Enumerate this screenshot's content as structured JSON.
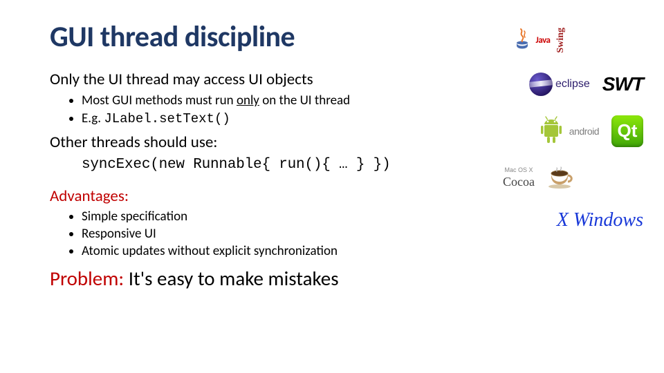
{
  "title": "GUI thread discipline",
  "section1": {
    "heading_a": "Only the UI thread may access UI objects",
    "bullet1_a": "Most GUI methods must run ",
    "bullet1_u": "only",
    "bullet1_b": " on the UI thread",
    "bullet2_a": "E.g. ",
    "bullet2_code": "JLabel.setText()"
  },
  "section2": {
    "heading": "Other threads should use:",
    "code": "syncExec(new Runnable{ run(){ … } })"
  },
  "advantages": {
    "label": "Advantages:",
    "items": [
      "Simple specification",
      "Responsive UI",
      "Atomic updates without explicit synchronization"
    ]
  },
  "problem": {
    "label": "Problem:",
    "text": "  It's easy to make mistakes"
  },
  "logos": {
    "java": "Java",
    "swing": "Swing",
    "eclipse": "eclipse",
    "swt": "SWT",
    "android": "android",
    "qt": "Qt",
    "cocoa_small": "Mac OS X",
    "cocoa": "Cocoa",
    "xwindows": "X Windows"
  }
}
